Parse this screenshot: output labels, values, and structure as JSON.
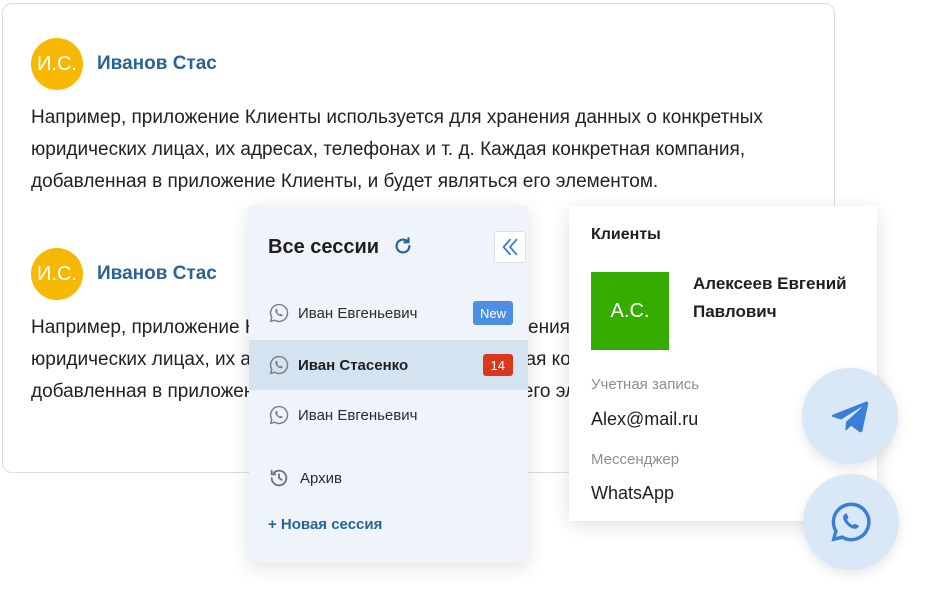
{
  "chat": {
    "messages": [
      {
        "avatar": "И.С.",
        "author": "Иванов Стас",
        "lines": [
          "Например, приложение Клиенты используется для хранения данных о конкретных",
          "юридических лицах, их адресах, телефонах и т. д. Каждая конкретная компания,",
          "добавленная в приложение Клиенты, и будет являться его элементом."
        ]
      },
      {
        "avatar": "И.С.",
        "author": "Иванов Стас",
        "lines": [
          "Например, приложение Клиенты используется для хранения данных о конкретных",
          "юридических лицах, их адресах, телефонах и т. д. Каждая конкретная компания,",
          "добавленная в приложение Клиенты, и будет являться его элементом."
        ]
      }
    ]
  },
  "sessions": {
    "title": "Все сессии",
    "items": [
      {
        "name": "Иван Евгеньевич",
        "badge": "New",
        "icon": "whatsapp-icon"
      },
      {
        "name": "Иван Стасенко",
        "badge": "14",
        "icon": "whatsapp-icon",
        "active": true
      },
      {
        "name": "Иван Евгеньевич",
        "badge": "",
        "icon": "whatsapp-icon"
      }
    ],
    "archive_label": "Архив",
    "new_session_label": "+ Новая сессия"
  },
  "client": {
    "title": "Клиенты",
    "avatar": "А.С.",
    "name": "Алексеев Евгений Павлович",
    "account_label": "Учетная запись",
    "account_value": "Alex@mail.ru",
    "messenger_label": "Мессенджер",
    "messenger_value": "WhatsApp"
  },
  "colors": {
    "accent": "#2a6396",
    "avatar_yellow": "#f6b800",
    "avatar_green": "#34ad00",
    "badge_new": "#4e8fe3",
    "badge_count": "#d9381e",
    "panel_bg": "#eef4f9",
    "active_row": "#d3e3ef",
    "icon_blue": "#3a7fd5"
  },
  "floating_icons": [
    "telegram-icon",
    "whatsapp-icon"
  ]
}
